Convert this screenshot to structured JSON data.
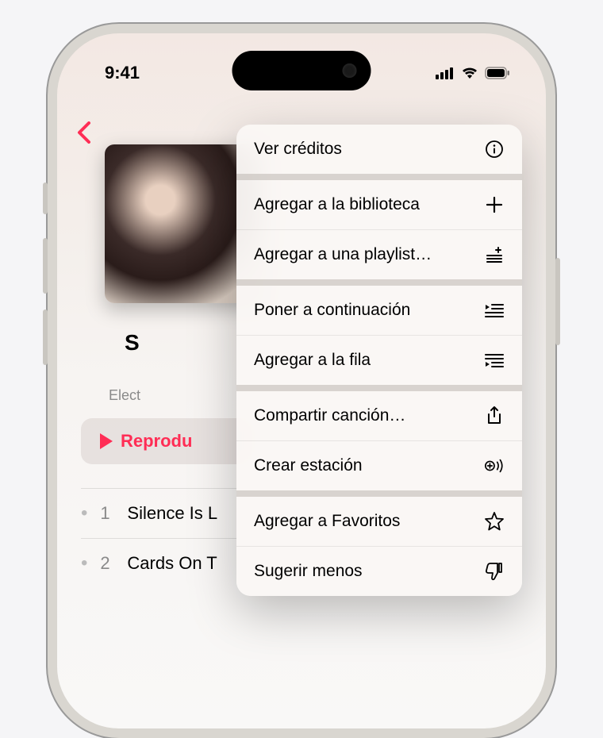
{
  "status": {
    "time": "9:41"
  },
  "nav": {
    "play_label": "Reprodu",
    "genre_partial": "Elect",
    "title_partial": "S"
  },
  "tracks": [
    {
      "num": "1",
      "title": "Silence Is L"
    },
    {
      "num": "2",
      "title": "Cards On T"
    }
  ],
  "menu": {
    "credits": "Ver créditos",
    "add_library": "Agregar a la biblioteca",
    "add_playlist": "Agregar a una playlist…",
    "play_next": "Poner a continuación",
    "add_queue": "Agregar a la fila",
    "share_song": "Compartir canción…",
    "create_station": "Crear estación",
    "add_favorites": "Agregar a Favoritos",
    "suggest_less": "Sugerir menos"
  }
}
